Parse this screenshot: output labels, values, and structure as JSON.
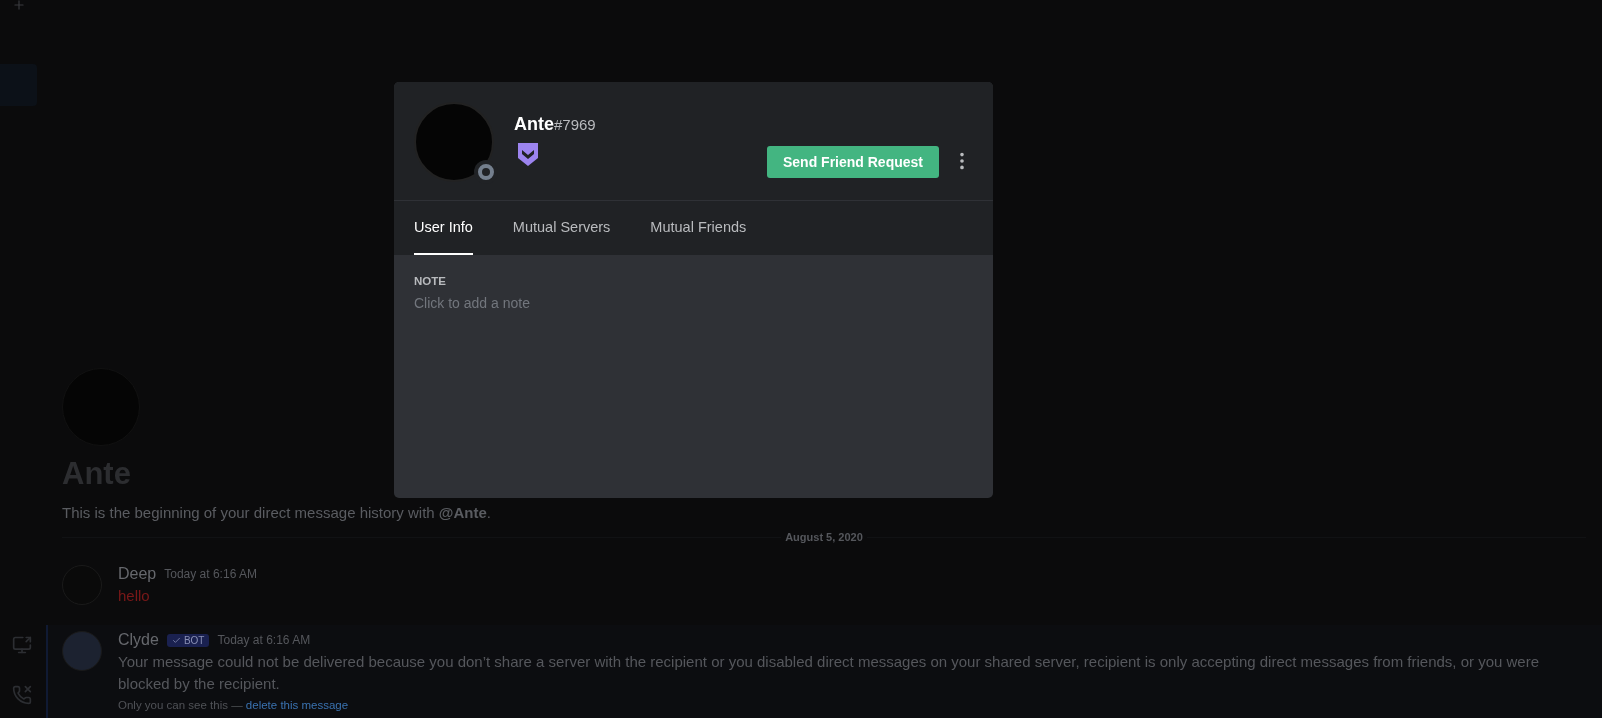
{
  "chat": {
    "title": "Ante",
    "intro": "This is the beginning of your direct message history with **@Ante**.",
    "date_divider": "August 5, 2020",
    "messages": [
      {
        "author": "Deep",
        "timestamp": "Today at 6:16 AM",
        "text": "hello",
        "color": "#7a1818",
        "highlighted": false
      },
      {
        "author": "Clyde",
        "timestamp": "Today at 6:16 AM",
        "text": "Your message could not be delivered because you don’t share a server with the recipient or you disabled direct messages on your shared server, recipient is only accepting direct messages from friends, or you were blocked by the recipient.",
        "color": "#55575c",
        "bot_badge": "BOT",
        "highlighted": true,
        "note": "Only you can see this —",
        "note_link": "delete this message"
      }
    ]
  },
  "profile": {
    "username": "Ante",
    "discriminator": "#7969",
    "offline": true,
    "button": "Send Friend Request",
    "tabs": [
      {
        "label": "User Info",
        "selected": true
      },
      {
        "label": "Mutual Servers",
        "selected": false
      },
      {
        "label": "Mutual Friends",
        "selected": false
      }
    ],
    "note": {
      "label": "NOTE",
      "placeholder": "Click to add a note"
    }
  }
}
